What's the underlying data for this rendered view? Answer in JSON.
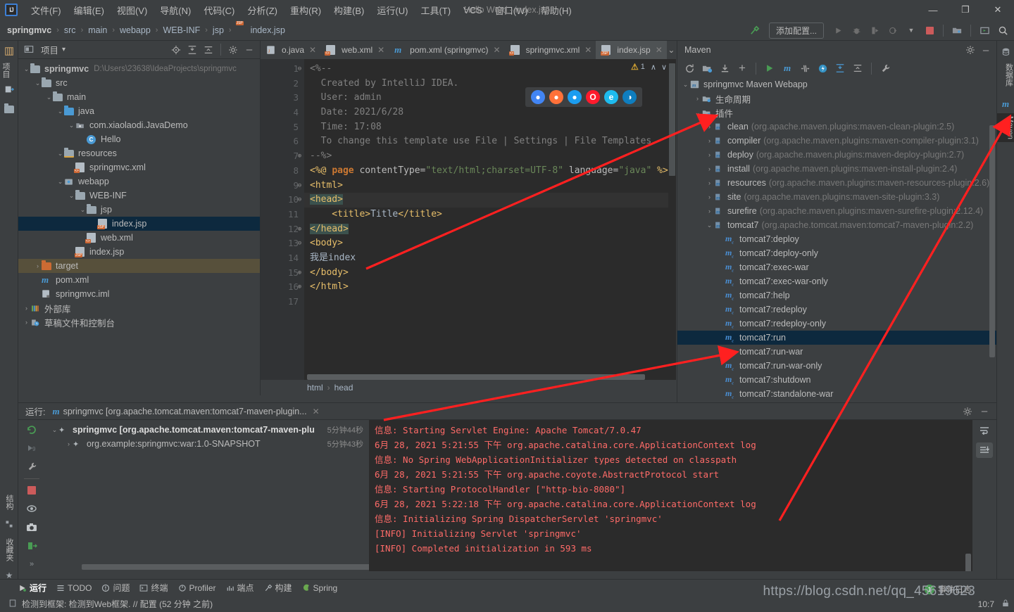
{
  "window": {
    "title": "Hello Word - index.jsp",
    "minimize": "—",
    "maximize": "❐",
    "close": "✕",
    "logo": "IJ"
  },
  "menu": {
    "items": [
      {
        "label": "文件(F)",
        "name": "menu-file"
      },
      {
        "label": "编辑(E)",
        "name": "menu-edit"
      },
      {
        "label": "视图(V)",
        "name": "menu-view"
      },
      {
        "label": "导航(N)",
        "name": "menu-navigate"
      },
      {
        "label": "代码(C)",
        "name": "menu-code"
      },
      {
        "label": "分析(Z)",
        "name": "menu-analyze"
      },
      {
        "label": "重构(R)",
        "name": "menu-refactor"
      },
      {
        "label": "构建(B)",
        "name": "menu-build"
      },
      {
        "label": "运行(U)",
        "name": "menu-run"
      },
      {
        "label": "工具(T)",
        "name": "menu-tools"
      },
      {
        "label": "VCS",
        "name": "menu-vcs"
      },
      {
        "label": "窗口(W)",
        "name": "menu-window"
      },
      {
        "label": "帮助(H)",
        "name": "menu-help"
      }
    ]
  },
  "navbar": {
    "crumbs": [
      "springmvc",
      "src",
      "main",
      "webapp",
      "WEB-INF",
      "jsp",
      "index.jsp"
    ],
    "separator": "›",
    "add_config_label": "添加配置...",
    "icons": {
      "build": "build-hammer-icon",
      "run": "run-icon",
      "debug": "debug-icon",
      "coverage": "coverage-icon",
      "profile": "profile-icon",
      "dropdown": "chevron-down-icon",
      "stop": "stop-icon",
      "project_structure": "project-structure-icon",
      "select_target": "select-target-icon",
      "search": "search-icon"
    }
  },
  "left_strip": {
    "tabs": [
      {
        "label": "项目",
        "name": "strip-tab-project"
      },
      {
        "label": "",
        "name": "strip-tab-commit"
      }
    ],
    "bottom_tabs": [
      {
        "label": "结构",
        "name": "strip-tab-structure"
      },
      {
        "label": "收藏夹",
        "name": "strip-tab-favorites"
      }
    ]
  },
  "right_strip": {
    "tabs": [
      {
        "label": "数据库",
        "name": "strip-tab-database"
      },
      {
        "label": "Maven",
        "name": "strip-tab-maven"
      }
    ]
  },
  "project_panel": {
    "title": "项目",
    "dropdown": "▾",
    "icons": [
      "locate-icon",
      "expand-all-icon",
      "collapse-all-icon",
      "gear-icon",
      "hide-icon"
    ],
    "tree": [
      {
        "depth": 0,
        "arrow": "⌄",
        "icon": "module-folder",
        "label": "springmvc",
        "bold": true,
        "path": "D:\\Users\\23638\\IdeaProjects\\springmvc",
        "name": "tree-node-springmvc"
      },
      {
        "depth": 1,
        "arrow": "⌄",
        "icon": "folder",
        "label": "src",
        "name": "tree-node-src"
      },
      {
        "depth": 2,
        "arrow": "⌄",
        "icon": "folder",
        "label": "main",
        "name": "tree-node-main"
      },
      {
        "depth": 3,
        "arrow": "⌄",
        "icon": "folder-blue",
        "label": "java",
        "name": "tree-node-java"
      },
      {
        "depth": 4,
        "arrow": "⌄",
        "icon": "package",
        "label": "com.xiaolaodi.JavaDemo",
        "name": "tree-node-package"
      },
      {
        "depth": 5,
        "arrow": "",
        "icon": "class",
        "label": "Hello",
        "name": "tree-node-hello"
      },
      {
        "depth": 3,
        "arrow": "⌄",
        "icon": "folder-res",
        "label": "resources",
        "name": "tree-node-resources"
      },
      {
        "depth": 4,
        "arrow": "",
        "icon": "xml",
        "label": "springmvc.xml",
        "name": "tree-node-springmvc-xml"
      },
      {
        "depth": 3,
        "arrow": "⌄",
        "icon": "folder-web",
        "label": "webapp",
        "name": "tree-node-webapp"
      },
      {
        "depth": 4,
        "arrow": "⌄",
        "icon": "folder",
        "label": "WEB-INF",
        "name": "tree-node-webinf"
      },
      {
        "depth": 5,
        "arrow": "⌄",
        "icon": "folder",
        "label": "jsp",
        "name": "tree-node-jsp"
      },
      {
        "depth": 6,
        "arrow": "",
        "icon": "jsp",
        "label": "index.jsp",
        "selected": true,
        "name": "tree-node-index-jsp-inner"
      },
      {
        "depth": 5,
        "arrow": "",
        "icon": "xml",
        "label": "web.xml",
        "name": "tree-node-web-xml"
      },
      {
        "depth": 4,
        "arrow": "",
        "icon": "jsp",
        "label": "index.jsp",
        "name": "tree-node-index-jsp"
      },
      {
        "depth": 1,
        "arrow": "›",
        "icon": "folder-orange",
        "label": "target",
        "highlight": true,
        "name": "tree-node-target"
      },
      {
        "depth": 1,
        "arrow": "",
        "icon": "maven",
        "label": "pom.xml",
        "name": "tree-node-pom-xml"
      },
      {
        "depth": 1,
        "arrow": "",
        "icon": "iml",
        "label": "springmvc.iml",
        "name": "tree-node-iml"
      },
      {
        "depth": 0,
        "arrow": "›",
        "icon": "library",
        "label": "外部库",
        "name": "tree-node-external-libraries"
      },
      {
        "depth": 0,
        "arrow": "›",
        "icon": "scratch",
        "label": "草稿文件和控制台",
        "name": "tree-node-scratches"
      }
    ]
  },
  "editor": {
    "tabs": [
      {
        "label": "o.java",
        "icon": "java",
        "active": false,
        "name": "editor-tab-hello-java"
      },
      {
        "label": "web.xml",
        "icon": "xml",
        "active": false,
        "name": "editor-tab-web-xml"
      },
      {
        "label": "pom.xml (springmvc)",
        "icon": "maven",
        "active": false,
        "name": "editor-tab-pom-xml"
      },
      {
        "label": "springmvc.xml",
        "icon": "xml",
        "active": false,
        "name": "editor-tab-springmvc-xml"
      },
      {
        "label": "index.jsp",
        "icon": "jsp",
        "active": true,
        "name": "editor-tab-index-jsp"
      }
    ],
    "close_glyph": "✕",
    "more_glyph": "⌄",
    "warning_count": "1",
    "warning_glyph": "⚠",
    "nav_up": "∧",
    "nav_down": "∨",
    "browsers": [
      {
        "name": "chrome-icon",
        "glyph": "●",
        "color": "#4285f4"
      },
      {
        "name": "firefox-icon",
        "glyph": "●",
        "color": "#ff7139"
      },
      {
        "name": "safari-icon",
        "glyph": "●",
        "color": "#1b9df0"
      },
      {
        "name": "opera-icon",
        "glyph": "O",
        "color": "#ff1b2d"
      },
      {
        "name": "ie-icon",
        "glyph": "e",
        "color": "#1ebbee"
      },
      {
        "name": "edge-icon",
        "glyph": "◑",
        "color": "#0f7ebf"
      }
    ],
    "lines": [
      {
        "n": 1,
        "fold": "⊖",
        "segments": [
          {
            "t": "<%--",
            "c": "cmt"
          }
        ]
      },
      {
        "n": 2,
        "fold": "",
        "segments": [
          {
            "t": "  Created by IntelliJ IDEA.",
            "c": "cmt"
          }
        ]
      },
      {
        "n": 3,
        "fold": "",
        "segments": [
          {
            "t": "  User: admin",
            "c": "cmt"
          }
        ]
      },
      {
        "n": 4,
        "fold": "",
        "segments": [
          {
            "t": "  Date: 2021/6/28",
            "c": "cmt"
          }
        ]
      },
      {
        "n": 5,
        "fold": "",
        "segments": [
          {
            "t": "  Time: 17:08",
            "c": "cmt"
          }
        ]
      },
      {
        "n": 6,
        "fold": "",
        "segments": [
          {
            "t": "  To change this template use File | Settings | File Templates.",
            "c": "cmt"
          }
        ]
      },
      {
        "n": 7,
        "fold": "⊕",
        "segments": [
          {
            "t": "--%>",
            "c": "cmt"
          }
        ]
      },
      {
        "n": 8,
        "fold": "",
        "segments": [
          {
            "t": "<%@ ",
            "c": "tag"
          },
          {
            "t": "page ",
            "c": "kw"
          },
          {
            "t": "contentType=",
            "c": "attr"
          },
          {
            "t": "\"text/html;charset=UTF-8\"",
            "c": "str"
          },
          {
            "t": " language=",
            "c": "attr"
          },
          {
            "t": "\"java\"",
            "c": "str"
          },
          {
            "t": " %>",
            "c": "tag"
          }
        ]
      },
      {
        "n": 9,
        "fold": "⊖",
        "segments": [
          {
            "t": "<html>",
            "c": "tag"
          }
        ]
      },
      {
        "n": 10,
        "fold": "⊖",
        "hl": true,
        "segments": [
          {
            "t": "<head>",
            "c": "tagbg"
          }
        ]
      },
      {
        "n": 11,
        "fold": "",
        "segments": [
          {
            "t": "    <title>",
            "c": "tag"
          },
          {
            "t": "Title",
            "c": "txt"
          },
          {
            "t": "</title>",
            "c": "tag"
          }
        ]
      },
      {
        "n": 12,
        "fold": "⊕",
        "segments": [
          {
            "t": "</head>",
            "c": "tagbg"
          }
        ]
      },
      {
        "n": 13,
        "fold": "⊖",
        "segments": [
          {
            "t": "<body>",
            "c": "tag"
          }
        ]
      },
      {
        "n": 14,
        "fold": "",
        "segments": [
          {
            "t": "我是index",
            "c": "txt"
          }
        ]
      },
      {
        "n": 15,
        "fold": "⊕",
        "segments": [
          {
            "t": "</body>",
            "c": "tag"
          }
        ]
      },
      {
        "n": 16,
        "fold": "⊕",
        "segments": [
          {
            "t": "</html>",
            "c": "tag"
          }
        ]
      },
      {
        "n": 17,
        "fold": "",
        "segments": [
          {
            "t": "",
            "c": "txt"
          }
        ]
      }
    ],
    "breadcrumbs": [
      "html",
      "head"
    ],
    "breadcrumb_sep": "›"
  },
  "maven_panel": {
    "title": "Maven",
    "header_icons": [
      "gear-icon",
      "hide-icon"
    ],
    "toolbar_icons": [
      "reload-icon",
      "add-maven-projects-icon",
      "download-sources-icon",
      "plus-icon",
      "execute-goal-icon",
      "maven-m-icon",
      "toggle-skip-tests-icon",
      "offline-mode-icon",
      "expand-all-icon",
      "collapse-all-icon",
      "settings-wrench-icon"
    ],
    "tree": [
      {
        "depth": 0,
        "arrow": "⌄",
        "icon": "maven-project",
        "label": "springmvc Maven Webapp",
        "name": "maven-node-project"
      },
      {
        "depth": 1,
        "arrow": "›",
        "icon": "folder-cfg",
        "label": "生命周期",
        "name": "maven-node-lifecycle"
      },
      {
        "depth": 1,
        "arrow": "⌄",
        "icon": "folder-cfg",
        "label": "插件",
        "name": "maven-node-plugins"
      },
      {
        "depth": 2,
        "arrow": "›",
        "icon": "plugin",
        "label": "clean",
        "coord": "(org.apache.maven.plugins:maven-clean-plugin:2.5)",
        "name": "maven-node-clean"
      },
      {
        "depth": 2,
        "arrow": "›",
        "icon": "plugin",
        "label": "compiler",
        "coord": "(org.apache.maven.plugins:maven-compiler-plugin:3.1)",
        "name": "maven-node-compiler"
      },
      {
        "depth": 2,
        "arrow": "›",
        "icon": "plugin",
        "label": "deploy",
        "coord": "(org.apache.maven.plugins:maven-deploy-plugin:2.7)",
        "name": "maven-node-deploy"
      },
      {
        "depth": 2,
        "arrow": "›",
        "icon": "plugin",
        "label": "install",
        "coord": "(org.apache.maven.plugins:maven-install-plugin:2.4)",
        "name": "maven-node-install"
      },
      {
        "depth": 2,
        "arrow": "›",
        "icon": "plugin",
        "label": "resources",
        "coord": "(org.apache.maven.plugins:maven-resources-plugin:2.6)",
        "name": "maven-node-resources"
      },
      {
        "depth": 2,
        "arrow": "›",
        "icon": "plugin",
        "label": "site",
        "coord": "(org.apache.maven.plugins:maven-site-plugin:3.3)",
        "name": "maven-node-site"
      },
      {
        "depth": 2,
        "arrow": "›",
        "icon": "plugin",
        "label": "surefire",
        "coord": "(org.apache.maven.plugins:maven-surefire-plugin:2.12.4)",
        "name": "maven-node-surefire"
      },
      {
        "depth": 2,
        "arrow": "⌄",
        "icon": "plugin",
        "label": "tomcat7",
        "coord": "(org.apache.tomcat.maven:tomcat7-maven-plugin:2.2)",
        "name": "maven-node-tomcat7"
      },
      {
        "depth": 3,
        "arrow": "",
        "icon": "goal",
        "label": "tomcat7:deploy",
        "name": "maven-goal-deploy"
      },
      {
        "depth": 3,
        "arrow": "",
        "icon": "goal",
        "label": "tomcat7:deploy-only",
        "name": "maven-goal-deploy-only"
      },
      {
        "depth": 3,
        "arrow": "",
        "icon": "goal",
        "label": "tomcat7:exec-war",
        "name": "maven-goal-exec-war"
      },
      {
        "depth": 3,
        "arrow": "",
        "icon": "goal",
        "label": "tomcat7:exec-war-only",
        "name": "maven-goal-exec-war-only"
      },
      {
        "depth": 3,
        "arrow": "",
        "icon": "goal",
        "label": "tomcat7:help",
        "name": "maven-goal-help"
      },
      {
        "depth": 3,
        "arrow": "",
        "icon": "goal",
        "label": "tomcat7:redeploy",
        "name": "maven-goal-redeploy"
      },
      {
        "depth": 3,
        "arrow": "",
        "icon": "goal",
        "label": "tomcat7:redeploy-only",
        "name": "maven-goal-redeploy-only"
      },
      {
        "depth": 3,
        "arrow": "",
        "icon": "goal",
        "label": "tomcat7:run",
        "selected": true,
        "name": "maven-goal-run"
      },
      {
        "depth": 3,
        "arrow": "",
        "icon": "goal",
        "label": "tomcat7:run-war",
        "name": "maven-goal-run-war"
      },
      {
        "depth": 3,
        "arrow": "",
        "icon": "goal",
        "label": "tomcat7:run-war-only",
        "name": "maven-goal-run-war-only"
      },
      {
        "depth": 3,
        "arrow": "",
        "icon": "goal",
        "label": "tomcat7:shutdown",
        "name": "maven-goal-shutdown"
      },
      {
        "depth": 3,
        "arrow": "",
        "icon": "goal",
        "label": "tomcat7:standalone-war",
        "name": "maven-goal-standalone-war"
      }
    ]
  },
  "run_panel": {
    "label": "运行:",
    "tab_label": "springmvc [org.apache.tomcat.maven:tomcat7-maven-plugin...",
    "tab_close": "✕",
    "header_icons": [
      "gear-icon",
      "hide-icon"
    ],
    "sidebar_icons": [
      "rerun-icon",
      "rerun-failed-icon",
      "settings-wrench-icon",
      "stop-icon",
      "toggle-eye-icon",
      "camera-icon",
      "export-icon",
      "expand-more-icon"
    ],
    "right_icons": [
      "soft-wrap-icon",
      "scroll-to-end-icon"
    ],
    "tree": [
      {
        "depth": 0,
        "arrow": "⌄",
        "label": "springmvc [org.apache.tomcat.maven:tomcat7-maven-plu",
        "bold": true,
        "time": "5分钟44秒",
        "name": "run-tree-root"
      },
      {
        "depth": 1,
        "arrow": "›",
        "label": "org.example:springmvc:war:1.0-SNAPSHOT",
        "bold": false,
        "time": "5分钟43秒",
        "name": "run-tree-module"
      }
    ],
    "console_lines": [
      "信息: Starting Servlet Engine: Apache Tomcat/7.0.47",
      "6月 28, 2021 5:21:55 下午 org.apache.catalina.core.ApplicationContext log",
      "信息: No Spring WebApplicationInitializer types detected on classpath",
      "6月 28, 2021 5:21:55 下午 org.apache.coyote.AbstractProtocol start",
      "信息: Starting ProtocolHandler [\"http-bio-8080\"]",
      "6月 28, 2021 5:22:18 下午 org.apache.catalina.core.ApplicationContext log",
      "信息: Initializing Spring DispatcherServlet 'springmvc'",
      "[INFO] Initializing Servlet 'springmvc'",
      "[INFO] Completed initialization in 593 ms"
    ]
  },
  "status_bar": {
    "tools": [
      {
        "label": "运行",
        "icon": "run-icon",
        "active": true,
        "name": "status-tool-run"
      },
      {
        "label": "TODO",
        "icon": "todo-icon",
        "active": false,
        "name": "status-tool-todo"
      },
      {
        "label": "问题",
        "icon": "problems-icon",
        "active": false,
        "name": "status-tool-problems"
      },
      {
        "label": "终端",
        "icon": "terminal-icon",
        "active": false,
        "name": "status-tool-terminal"
      },
      {
        "label": "Profiler",
        "icon": "profiler-icon",
        "active": false,
        "name": "status-tool-profiler"
      },
      {
        "label": "端点",
        "icon": "endpoints-icon",
        "active": false,
        "name": "status-tool-endpoints"
      },
      {
        "label": "构建",
        "icon": "build-icon",
        "active": false,
        "name": "status-tool-build"
      },
      {
        "label": "Spring",
        "icon": "spring-icon",
        "active": false,
        "name": "status-tool-spring"
      }
    ],
    "message": "检测到框架: 检测到Web框架. // 配置 (52 分钟 之前)",
    "message_icon": "notification-icon",
    "event_log_label": "事件日志",
    "event_log_badge": "1",
    "caret_position": "10:7",
    "lock_icon": "lock-icon"
  },
  "watermark": "https://blog.csdn.net/qq_45619623",
  "colors": {
    "panel_bg": "#3c3f41",
    "editor_bg": "#2b2b2b",
    "selection": "#0d293e",
    "accent_blue": "#4a9ad4",
    "arrow_red": "#ff2020",
    "console_red": "#ff6b68"
  }
}
